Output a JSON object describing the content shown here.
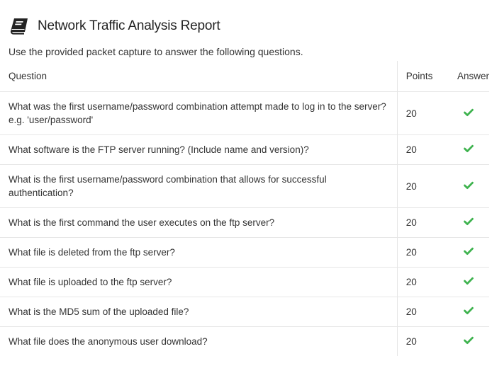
{
  "report": {
    "title": "Network Traffic Analysis Report",
    "intro": "Use the provided packet capture to answer the following questions.",
    "icon": "book-icon"
  },
  "table": {
    "headers": {
      "question": "Question",
      "points": "Points",
      "answer": "Answer"
    },
    "rows": [
      {
        "question": "What was the first username/password combination attempt made to log in to the server? e.g. 'user/password'",
        "points": "20",
        "answer": "check-icon"
      },
      {
        "question": "What software is the FTP server running? (Include name and version)?",
        "points": "20",
        "answer": "check-icon"
      },
      {
        "question": "What is the first username/password combination that allows for successful authentication?",
        "points": "20",
        "answer": "check-icon"
      },
      {
        "question": "What is the first command the user executes on the ftp server?",
        "points": "20",
        "answer": "check-icon"
      },
      {
        "question": "What file is deleted from the ftp server?",
        "points": "20",
        "answer": "check-icon"
      },
      {
        "question": "What file is uploaded to the ftp server?",
        "points": "20",
        "answer": "check-icon"
      },
      {
        "question": "What is the MD5 sum of the uploaded file?",
        "points": "20",
        "answer": "check-icon"
      },
      {
        "question": "What file does the anonymous user download?",
        "points": "20",
        "answer": "check-icon"
      }
    ]
  },
  "colors": {
    "check": "#3fb34f",
    "text": "#333333",
    "border": "#e6e6e6"
  }
}
